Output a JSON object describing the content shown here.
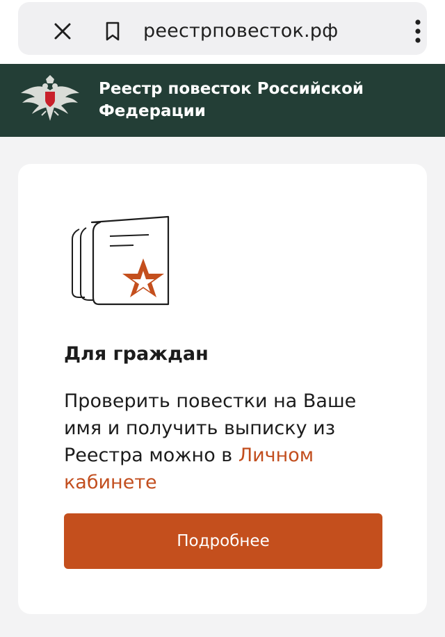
{
  "browser": {
    "url": "реестрповесток.рф",
    "icons": {
      "close": "close-icon",
      "bookmark": "bookmark-icon",
      "menu": "more-vert-icon"
    }
  },
  "header": {
    "title": "Реестр повесток Российской Федерации",
    "emblem_icon": "double-headed-eagle-emblem",
    "background": "#233e36"
  },
  "card": {
    "heading": "Для граждан",
    "text_before_link": "Проверить повестки на Ваше имя и получить выписку из Реестра можно в ",
    "link_text": "Личном кабинете",
    "button_label": "Подробнее",
    "illustration_icon": "document-star-icon"
  },
  "colors": {
    "accent": "#c44f1d",
    "header_bg": "#233e36",
    "page_bg": "#f3f3f4"
  }
}
